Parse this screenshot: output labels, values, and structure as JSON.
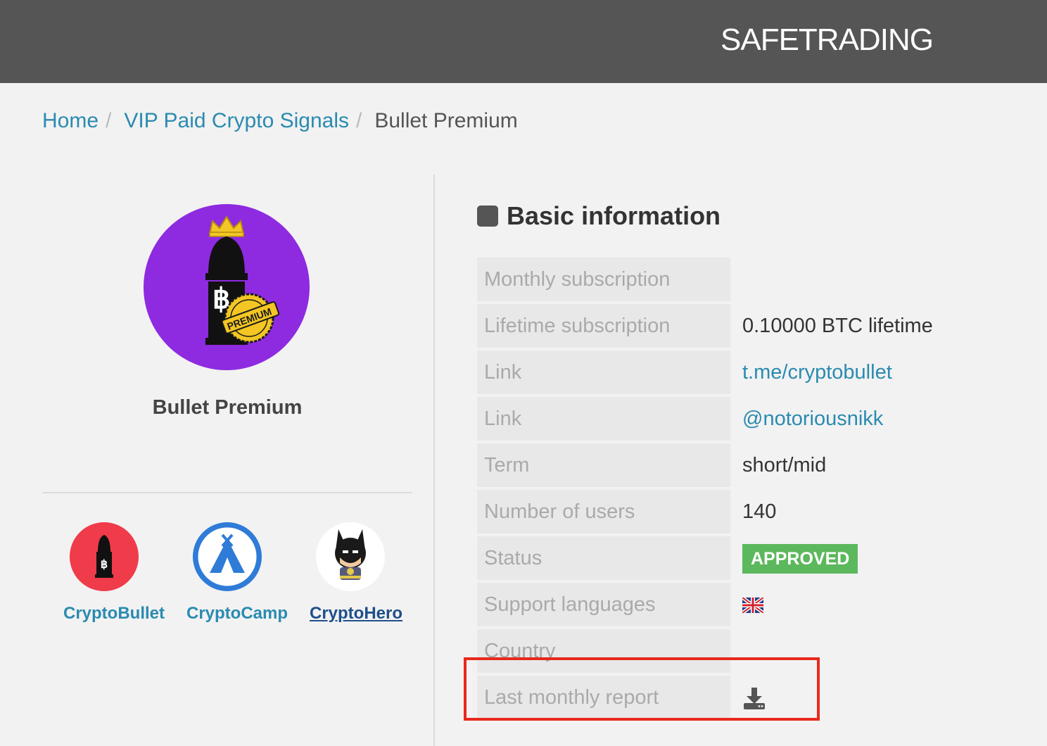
{
  "header": {
    "brand": "SAFETRADING"
  },
  "breadcrumb": {
    "home": "Home",
    "category": "VIP Paid Crypto Signals",
    "current": "Bullet Premium",
    "separator": "/"
  },
  "profile": {
    "name": "Bullet Premium",
    "logo_badge_text": "PREMIUM"
  },
  "related": [
    {
      "label": "CryptoBullet"
    },
    {
      "label": "CryptoCamp"
    },
    {
      "label": "CryptoHero"
    }
  ],
  "info": {
    "title": "Basic information",
    "rows": [
      {
        "key": "Monthly subscription",
        "value": ""
      },
      {
        "key": "Lifetime subscription",
        "value": "0.10000 BTC lifetime"
      },
      {
        "key": "Link",
        "value": "t.me/cryptobullet"
      },
      {
        "key": "Link",
        "value": "@notoriousnikk"
      },
      {
        "key": "Term",
        "value": "short/mid"
      },
      {
        "key": "Number of users",
        "value": "140"
      },
      {
        "key": "Status",
        "value": "APPROVED"
      },
      {
        "key": "Support languages",
        "value_icon": "uk-flag-icon"
      },
      {
        "key": "Country",
        "value": ""
      },
      {
        "key": "Last monthly report",
        "value_icon": "download-icon"
      }
    ]
  },
  "colors": {
    "header_bg": "#555555",
    "link": "#2a8bb0",
    "approved": "#5cb85c",
    "logo_purple": "#8e2ae0",
    "highlight": "#e8291c"
  }
}
